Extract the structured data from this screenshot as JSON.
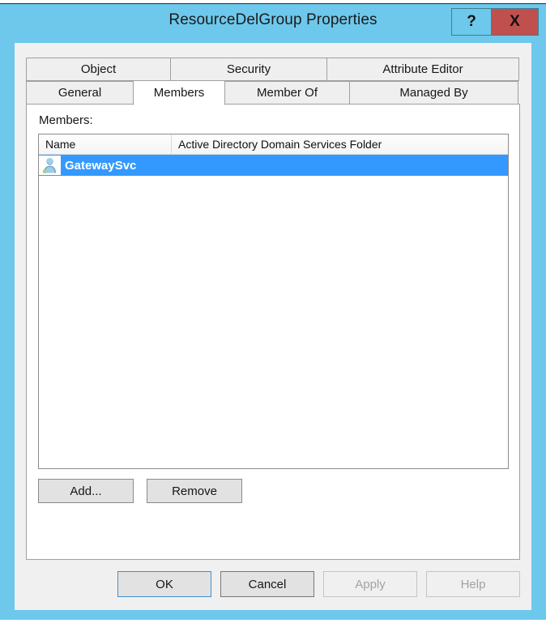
{
  "window": {
    "title": "ResourceDelGroup Properties",
    "accent_color": "#6DC8EC",
    "close_color": "#C0504D",
    "help_button_label": "?",
    "close_button_label": "X"
  },
  "tabs": {
    "top_row": [
      {
        "label": "Object",
        "active": false
      },
      {
        "label": "Security",
        "active": false
      },
      {
        "label": "Attribute Editor",
        "active": false
      }
    ],
    "bottom_row": [
      {
        "label": "General",
        "active": false
      },
      {
        "label": "Members",
        "active": true
      },
      {
        "label": "Member Of",
        "active": false
      },
      {
        "label": "Managed By",
        "active": false
      }
    ]
  },
  "members_pane": {
    "label": "Members:",
    "columns": [
      "Name",
      "Active Directory Domain Services Folder"
    ],
    "rows": [
      {
        "name": "GatewaySvc",
        "folder": "",
        "icon": "user-icon",
        "selected": true
      }
    ],
    "selection_color": "#3399FF",
    "add_button": "Add...",
    "remove_button": "Remove"
  },
  "dialog_buttons": [
    {
      "label": "OK",
      "state": "default"
    },
    {
      "label": "Cancel",
      "state": "normal"
    },
    {
      "label": "Apply",
      "state": "disabled"
    },
    {
      "label": "Help",
      "state": "disabled"
    }
  ]
}
